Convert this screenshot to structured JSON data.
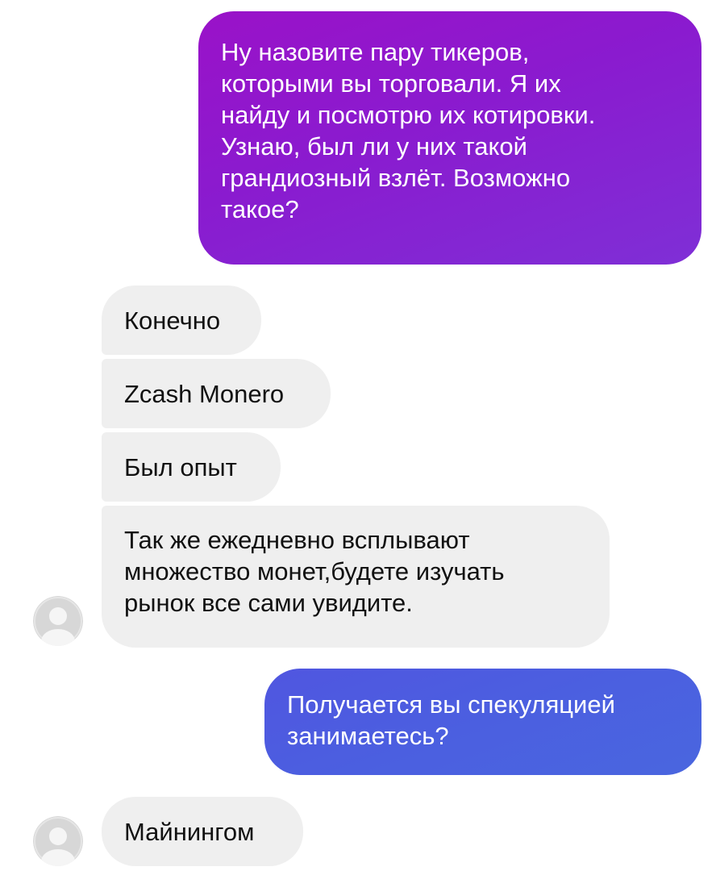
{
  "conversation": {
    "messages": [
      {
        "sender": "me",
        "text": "Ну назовите пару тикеров,\nкоторыми вы торговали. Я их\nнайду и посмотрю их котировки.\nУзнаю, был ли у них такой\nграндиозный взлёт. Возможно\nтакое?"
      },
      {
        "sender": "them",
        "text": "Конечно"
      },
      {
        "sender": "them",
        "text": "Zcash Monero"
      },
      {
        "sender": "them",
        "text": "Был опыт"
      },
      {
        "sender": "them",
        "text": "Так же ежедневно всплывают\nмножество монет,будете изучать\nрынок все сами увидите."
      },
      {
        "sender": "me",
        "text": "Получается вы спекуляцией\nзанимаетесь?"
      },
      {
        "sender": "them",
        "text": "Майнингом"
      }
    ],
    "avatar_icon": "default-user-avatar-icon"
  },
  "colors": {
    "outgoing_purple": "#8a1bcf",
    "outgoing_blue": "#4b5fe0",
    "incoming_bubble": "#efefef",
    "avatar_gray": "#d5d5d5"
  }
}
